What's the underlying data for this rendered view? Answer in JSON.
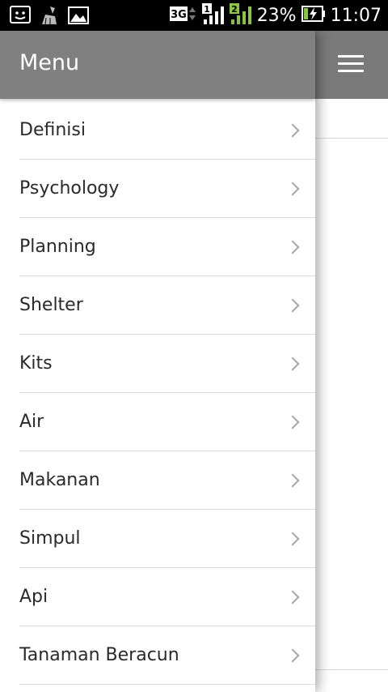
{
  "status_bar": {
    "network": "3G",
    "sim1": "1",
    "sim2": "2",
    "battery": "23%",
    "time": "11:07",
    "icons": [
      "notification-icon",
      "cleaner-icon",
      "image-icon",
      "signal-icon",
      "battery-charging-icon"
    ]
  },
  "drawer": {
    "title": "Menu",
    "items": [
      {
        "label": "Definisi"
      },
      {
        "label": "Psychology"
      },
      {
        "label": "Planning"
      },
      {
        "label": "Shelter"
      },
      {
        "label": "Kits"
      },
      {
        "label": "Air"
      },
      {
        "label": "Makanan"
      },
      {
        "label": "Simpul"
      },
      {
        "label": "Api"
      },
      {
        "label": "Tanaman Beracun"
      }
    ]
  },
  "colors": {
    "header": "#808080",
    "status_bar": "#000000",
    "divider": "#d9d9d9",
    "text": "#2a2a2a",
    "signal_green": "#8dc63f"
  }
}
